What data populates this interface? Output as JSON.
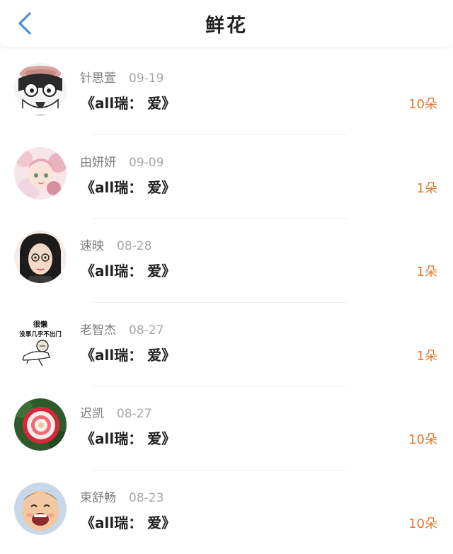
{
  "header": {
    "title": "鲜花",
    "back_icon": "chevron-left-icon",
    "accent_color": "#4a90d9"
  },
  "records": [
    {
      "name": "针思萱",
      "date": "09-19",
      "gift": "《all瑞： 爱》",
      "qty": "10朵"
    },
    {
      "name": "由妍妍",
      "date": "09-09",
      "gift": "《all瑞： 爱》",
      "qty": "1朵"
    },
    {
      "name": "速映",
      "date": "08-28",
      "gift": "《all瑞： 爱》",
      "qty": "1朵"
    },
    {
      "name": "老智杰",
      "date": "08-27",
      "gift": "《all瑞： 爱》",
      "qty": "1朵"
    },
    {
      "name": "迟凯",
      "date": "08-27",
      "gift": "《all瑞： 爱》",
      "qty": "10朵"
    },
    {
      "name": "束舒畅",
      "date": "08-23",
      "gift": "《all瑞： 爱》",
      "qty": "10朵"
    }
  ],
  "avatar_4_caption": [
    "很懒",
    "没事几乎不出门"
  ],
  "colors": {
    "quantity": "#e07a2d",
    "name": "#7c7c7c",
    "date": "#a6a6a6",
    "title": "#222222"
  }
}
